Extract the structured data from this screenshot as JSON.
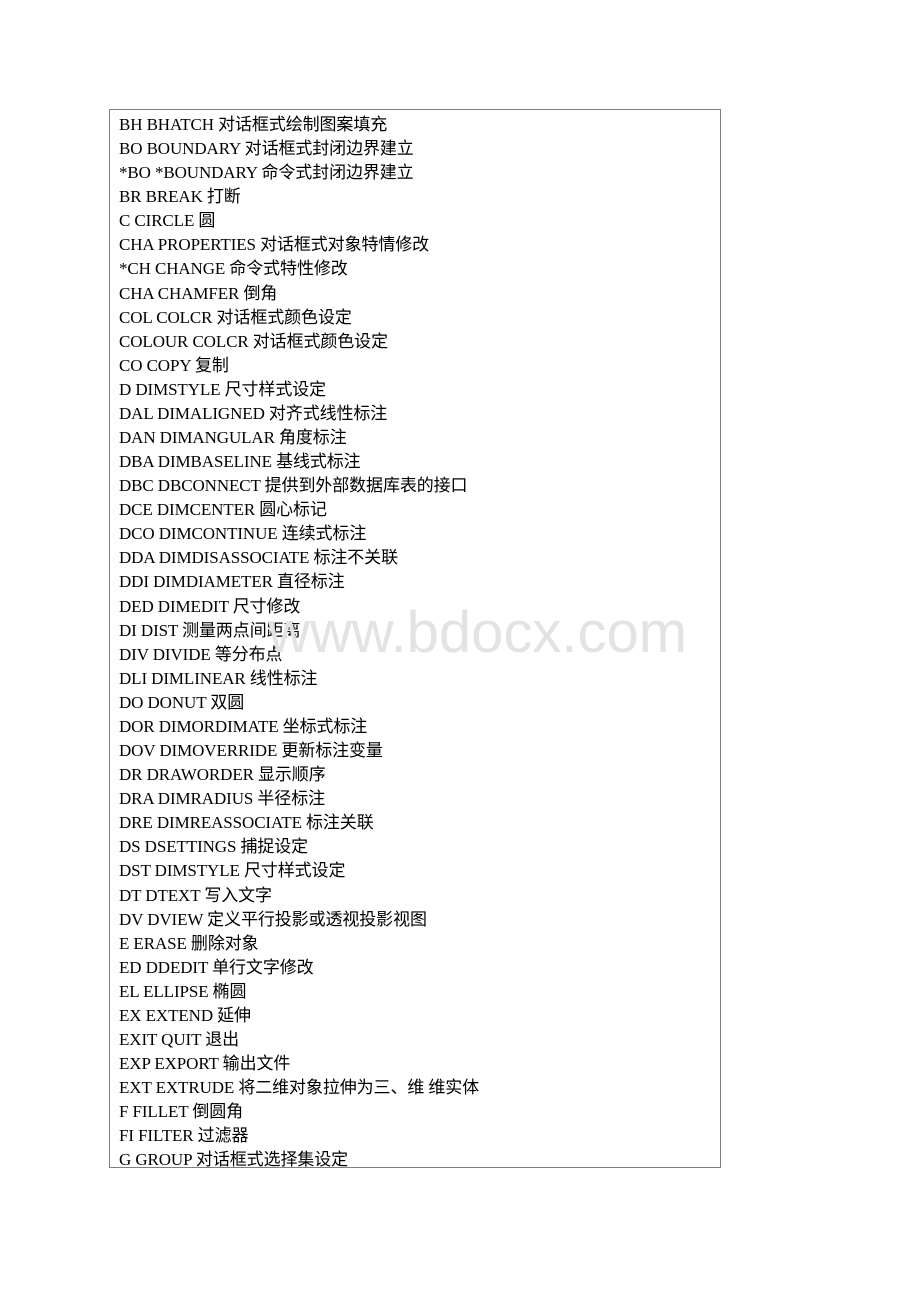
{
  "document": {
    "rows": [
      "BH BHATCH 对话框式绘制图案填充",
      "BO BOUNDARY 对话框式封闭边界建立",
      "*BO *BOUNDARY 命令式封闭边界建立",
      "BR BREAK 打断",
      "C CIRCLE 圆",
      "CHA PROPERTIES 对话框式对象特情修改",
      "*CH CHANGE 命令式特性修改",
      "CHA CHAMFER 倒角",
      "COL COLCR 对话框式颜色设定",
      "COLOUR COLCR 对话框式颜色设定",
      "CO COPY 复制",
      "D DIMSTYLE 尺寸样式设定",
      "DAL DIMALIGNED 对齐式线性标注",
      "DAN DIMANGULAR 角度标注",
      "DBA DIMBASELINE 基线式标注",
      "DBC DBCONNECT 提供到外部数据库表的接口",
      "DCE DIMCENTER 圆心标记",
      "DCO DIMCONTINUE 连续式标注",
      "DDA DIMDISASSOCIATE 标注不关联",
      "DDI DIMDIAMETER 直径标注",
      "DED DIMEDIT 尺寸修改",
      "DI DIST 测量两点间距离",
      "DIV DIVIDE 等分布点",
      "DLI DIMLINEAR 线性标注",
      "DO DONUT 双圆",
      "DOR DIMORDIMATE 坐标式标注",
      "DOV DIMOVERRIDE 更新标注变量",
      "DR DRAWORDER 显示顺序",
      "DRA DIMRADIUS 半径标注",
      "DRE DIMREASSOCIATE 标注关联",
      "DS DSETTINGS 捕捉设定",
      "DST DIMSTYLE 尺寸样式设定",
      "DT DTEXT 写入文字",
      "DV DVIEW 定义平行投影或透视投影视图",
      "E ERASE 删除对象",
      "ED DDEDIT 单行文字修改",
      "EL ELLIPSE 椭圆",
      "EX EXTEND 延伸",
      "EXIT QUIT 退出",
      "EXP EXPORT 输出文件",
      "EXT EXTRUDE 将二维对象拉伸为三、维 维实体",
      "F FILLET 倒圆角",
      "FI FILTER 过滤器",
      "G GROUP 对话框式选择集设定"
    ]
  },
  "watermark": {
    "text": "www.bdocx.com"
  }
}
